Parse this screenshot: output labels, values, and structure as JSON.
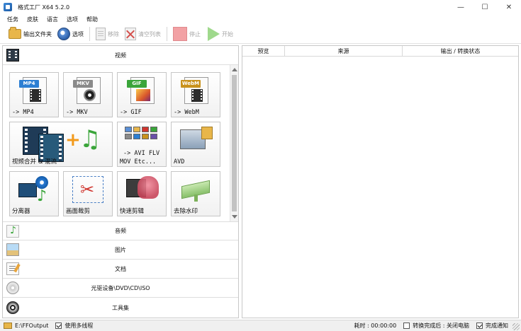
{
  "window": {
    "title": "格式工厂 X64 5.2.0",
    "controls": {
      "minimize": "—",
      "maximize": "☐",
      "close": "✕"
    }
  },
  "menu": [
    "任务",
    "皮肤",
    "语言",
    "选项",
    "帮助"
  ],
  "toolbar": {
    "output_folder": "输出文件夹",
    "options": "选项",
    "remove": "移除",
    "clear_list": "清空列表",
    "stop": "停止",
    "start": "开始"
  },
  "categories": {
    "video": "视频",
    "audio": "音频",
    "image": "图片",
    "document": "文档",
    "disc": "光驱设备\\DVD\\CD\\ISO",
    "toolbox": "工具集"
  },
  "video_tiles": {
    "mp4": {
      "badge": "MP4",
      "label": "-> MP4",
      "color": "#2d7fd3"
    },
    "mkv": {
      "badge": "MKV",
      "label": "-> MKV",
      "color": "#8a8a8a"
    },
    "gif": {
      "badge": "GIF",
      "label": "-> GIF",
      "color": "#3aa53a"
    },
    "webm": {
      "badge": "WebM",
      "label": "-> WebM",
      "color": "#c9921d"
    },
    "merge": {
      "label": "视频合并 & 混流"
    },
    "avi": {
      "line1": "-> AVI FLV",
      "line2": "MOV Etc..."
    },
    "other": {
      "label": "AVD"
    },
    "splitter": {
      "label": "分离器"
    },
    "crop": {
      "label": "画面裁剪"
    },
    "quick_clip": {
      "label": "快速剪辑"
    },
    "watermark": {
      "label": "去除水印"
    }
  },
  "task_table": {
    "columns": [
      "预览",
      "来源",
      "输出 / 转换状态"
    ]
  },
  "statusbar": {
    "output_path": "E:\\FFOutput",
    "multithread_label": "使用多线程",
    "elapsed_label": "耗时 : 00:00:00",
    "after_convert_label": "转换完成后 : 关闭电脑",
    "notify_label": "完成通知"
  }
}
